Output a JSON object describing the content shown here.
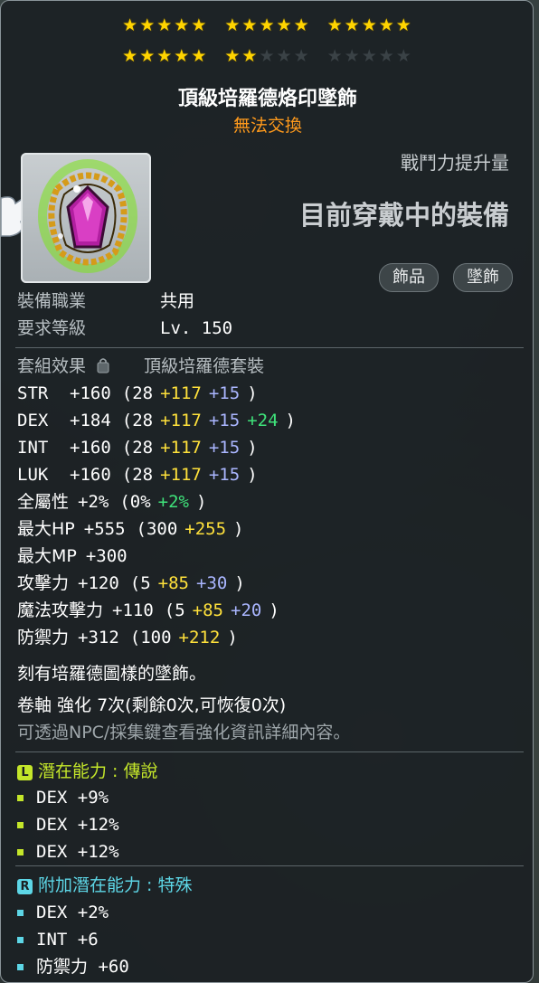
{
  "colors": {
    "star_filled": "#ffd400",
    "star_empty": "#3a4246",
    "untradeable": "#ff9a1c",
    "base_bonus": "#ffe13b",
    "enhance_bonus": "#aab6ff",
    "extra_bonus": "#3fe27a",
    "legendary": "#c4e62a",
    "special": "#5dd6e6"
  },
  "star_force": {
    "current": 22,
    "max": 25,
    "rows": [
      [
        [
          5,
          5
        ],
        [
          5,
          5
        ],
        [
          5,
          5
        ]
      ],
      [
        [
          5,
          5
        ],
        [
          2,
          5
        ],
        [
          0,
          5
        ]
      ]
    ]
  },
  "item": {
    "name": "頂級培羅德烙印墜飾",
    "trade_status": "無法交換",
    "icon": "pendant-icon",
    "combat_power_label": "戰鬥力提升量",
    "equipped_text": "目前穿戴中的裝備",
    "tags": [
      "飾品",
      "墜飾"
    ]
  },
  "requirements": {
    "job_label": "裝備職業",
    "job_value": "共用",
    "level_label": "要求等級",
    "level_value": "Lv. 150"
  },
  "set": {
    "label": "套組效果",
    "lock_icon": "lock-icon",
    "value": "頂級培羅德套裝"
  },
  "stats": [
    {
      "name": "STR",
      "total": "+160",
      "base": "(28",
      "bonus": "+117",
      "enh": "+15",
      "extra": "",
      "close": ")"
    },
    {
      "name": "DEX",
      "total": "+184",
      "base": "(28",
      "bonus": "+117",
      "enh": "+15",
      "extra": "+24",
      "close": ")"
    },
    {
      "name": "INT",
      "total": "+160",
      "base": "(28",
      "bonus": "+117",
      "enh": "+15",
      "extra": "",
      "close": ")"
    },
    {
      "name": "LUK",
      "total": "+160",
      "base": "(28",
      "bonus": "+117",
      "enh": "+15",
      "extra": "",
      "close": ")"
    },
    {
      "name": "全屬性",
      "total": "+2%",
      "base": "(0%",
      "bonus": "",
      "enh": "",
      "extra": "+2%",
      "close": ")"
    },
    {
      "name": "最大HP",
      "total": "+555",
      "base": "(300",
      "bonus": "+255",
      "enh": "",
      "extra": "",
      "close": ")"
    },
    {
      "name": "最大MP",
      "total": "+300",
      "base": "",
      "bonus": "",
      "enh": "",
      "extra": "",
      "close": ""
    },
    {
      "name": "攻擊力",
      "total": "+120",
      "base": "(5",
      "bonus": "+85",
      "enh": "+30",
      "extra": "",
      "close": ")"
    },
    {
      "name": "魔法攻擊力",
      "total": "+110",
      "base": "(5",
      "bonus": "+85",
      "enh": "+20",
      "extra": "",
      "close": ")"
    },
    {
      "name": "防禦力",
      "total": "+312",
      "base": "(100",
      "bonus": "+212",
      "enh": "",
      "extra": "",
      "close": ")"
    }
  ],
  "description": "刻有培羅德圖樣的墜飾。",
  "scroll": {
    "text": "卷軸 強化 7次(剩餘0次,可恢復0次)",
    "hint": "可透過NPC/採集鍵查看強化資訊詳細內容。"
  },
  "potential": {
    "badge": "L",
    "label": "潛在能力 : 傳說",
    "lines": [
      "DEX +9%",
      "DEX +12%",
      "DEX +12%"
    ]
  },
  "bonus_potential": {
    "badge": "R",
    "label": "附加潛在能力 : 特殊",
    "lines": [
      "DEX +2%",
      "INT +6",
      "防禦力 +60"
    ]
  }
}
